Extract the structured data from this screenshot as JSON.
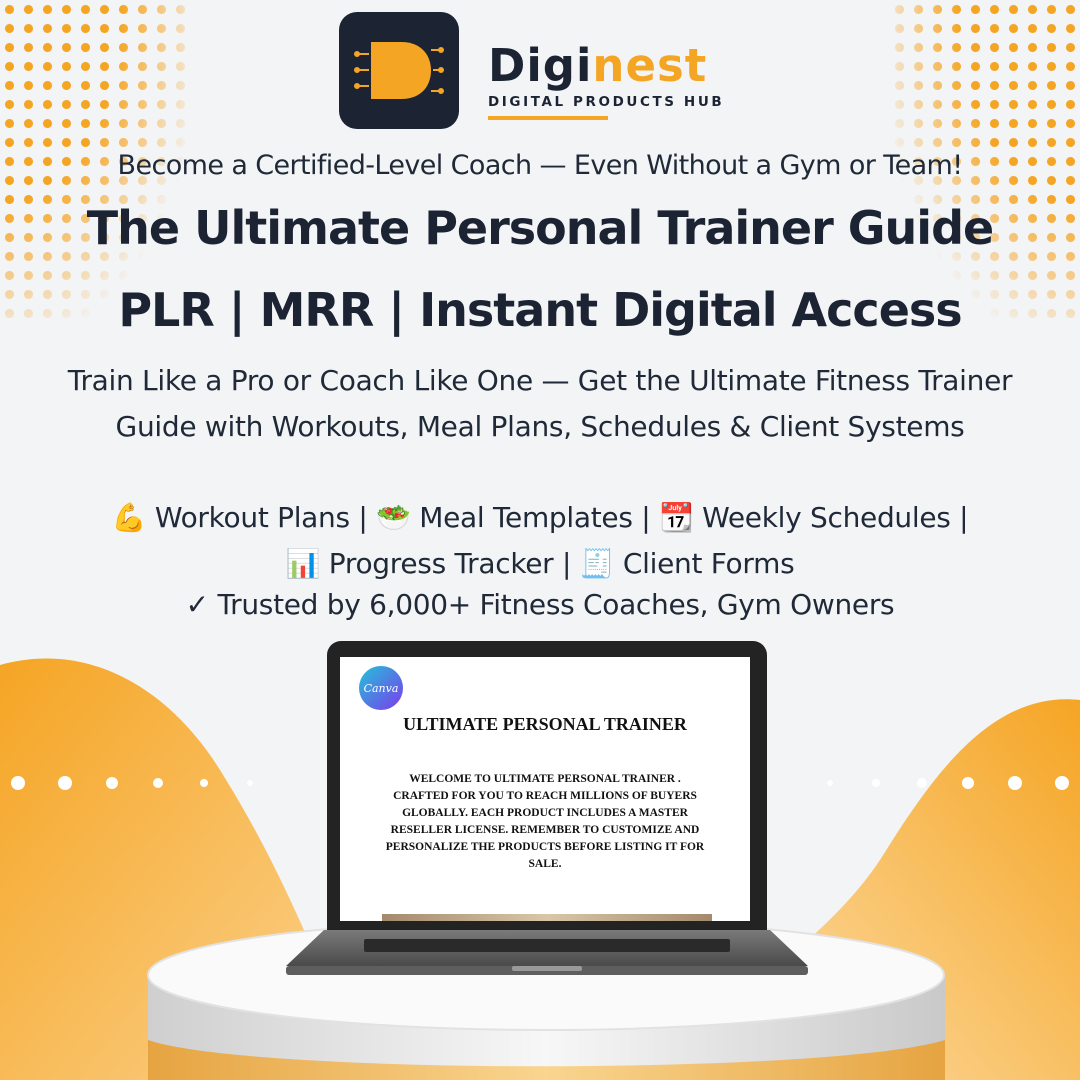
{
  "brand": {
    "name_part1": "Digi",
    "name_part2": "nest",
    "tagline": "DIGITAL PRODUCTS HUB",
    "logo_letter": "D"
  },
  "colors": {
    "accent": "#f5a524",
    "dark": "#1c2333",
    "background": "#f3f4f6"
  },
  "hero": {
    "subtitle": "Become a Certified-Level Coach — Even Without a Gym or Team!",
    "headline": "The Ultimate Personal Trainer Guide",
    "subheadline": "PLR | MRR | Instant Digital Access",
    "description": "Train Like a Pro or Coach Like One — Get the Ultimate Fitness Trainer Guide with Workouts, Meal Plans, Schedules & Client Systems",
    "features_line1": "💪 Workout Plans | 🥗 Meal Templates | 📆 Weekly Schedules |",
    "features_line2": "📊 Progress Tracker | 🧾 Client Forms",
    "trusted_check": "✓",
    "trusted_text": "Trusted by 6,000+ Fitness Coaches, Gym Owners"
  },
  "laptop_screen": {
    "badge": "Canva",
    "title": "ULTIMATE PERSONAL TRAINER",
    "body": "WELCOME TO ULTIMATE PERSONAL TRAINER . CRAFTED FOR YOU TO REACH MILLIONS OF BUYERS GLOBALLY. EACH PRODUCT INCLUDES A MASTER RESELLER LICENSE. REMEMBER TO CUSTOMIZE AND PERSONALIZE THE PRODUCTS BEFORE LISTING IT FOR SALE."
  },
  "icons": {
    "logo": "diginest-logo-icon",
    "check": "check-icon"
  }
}
